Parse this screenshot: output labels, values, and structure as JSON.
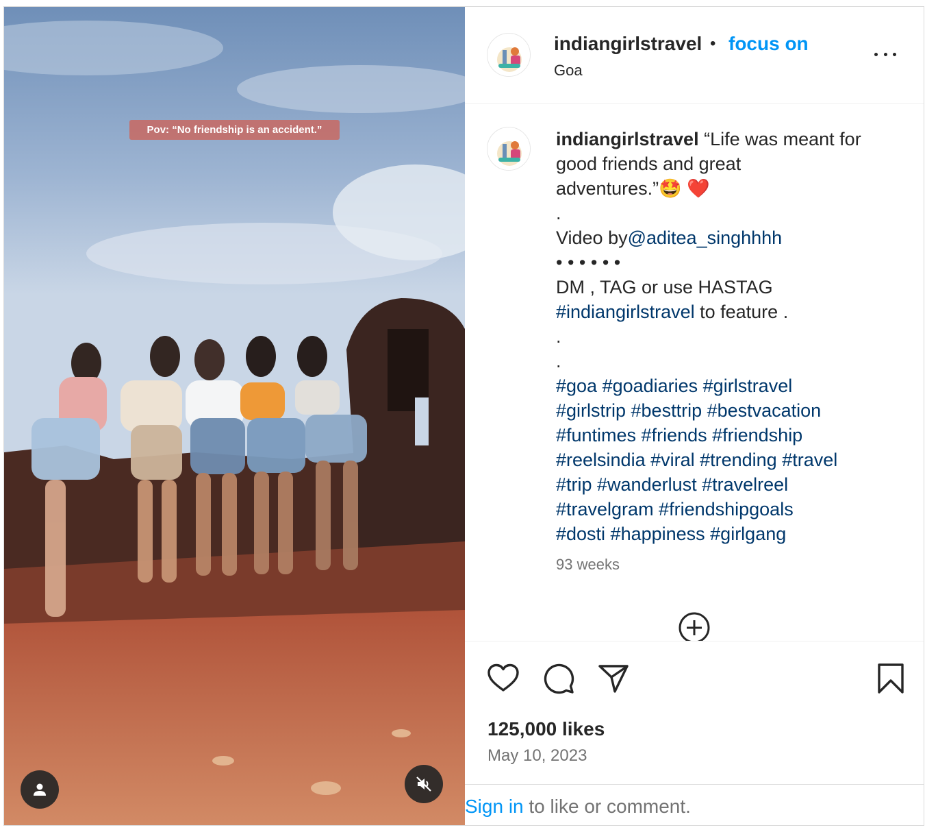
{
  "media": {
    "overlay_text": "Pov: “No friendship is an accident.”",
    "user_tag_icon": "person-icon",
    "mute_icon": "speaker-muted-icon"
  },
  "header": {
    "username": "indiangirlstravel",
    "separator": "•",
    "follow_label": "focus on",
    "location": "Goa",
    "more_icon": "more-options-icon"
  },
  "caption": {
    "username": "indiangirlstravel",
    "line1_text": "“Life was meant for",
    "line2": "good friends and great",
    "line3_text": "adventures.”",
    "line3_emoji": "🤩 ❤️",
    "dot1": ".",
    "credit_text": "Video by",
    "credit_mention": "@aditea_singhhhh",
    "bullets": "• • • • • •",
    "cta_line": "DM , TAG or use HASTAG",
    "cta_hashtag": "#indiangirlstravel",
    "cta_suffix": " to feature .",
    "dot2": ".",
    "dot3": ".",
    "hashtag_lines": [
      "#goa #goadiaries #girlstravel",
      "#girlstrip #besttrip #bestvacation",
      "#funtimes #friends #friendship",
      "#reelsindia #viral #trending #travel",
      "#trip #wanderlust #travelreel",
      "#travelgram #friendshipgoals",
      "#dosti #happiness #girlgang"
    ],
    "relative_time": "93 weeks"
  },
  "actions": {
    "like_icon": "heart-icon",
    "comment_icon": "comment-icon",
    "share_icon": "paper-plane-icon",
    "save_icon": "bookmark-icon",
    "load_more_icon": "plus-circle-icon",
    "likes": "125,000 likes",
    "date": "May 10, 2023"
  },
  "login": {
    "link": "Sign in",
    "rest": " to like or comment."
  },
  "colors": {
    "accent": "#0095f6",
    "hashtag": "#00376b",
    "muted": "#737373",
    "overlay_label": "#c46e69"
  }
}
